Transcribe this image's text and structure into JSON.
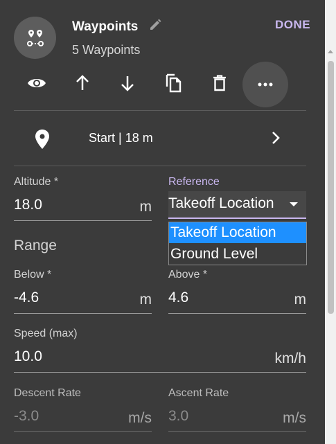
{
  "header": {
    "title": "Waypoints",
    "subtitle": "5 Waypoints",
    "done_label": "DONE"
  },
  "toolbar": {
    "icons": [
      "eye-icon",
      "arrow-up-icon",
      "arrow-down-icon",
      "copy-icon",
      "trash-icon",
      "more-horizontal-icon"
    ]
  },
  "start": {
    "label": "Start | 18 m"
  },
  "altitude": {
    "label": "Altitude *",
    "value": "18.0",
    "unit": "m"
  },
  "reference": {
    "label": "Reference",
    "selected": "Takeoff Location",
    "options": [
      "Takeoff Location",
      "Ground Level"
    ]
  },
  "range": {
    "heading": "Range",
    "below": {
      "label": "Below *",
      "value": "-4.6",
      "unit": "m"
    },
    "above": {
      "label": "Above *",
      "value": "4.6",
      "unit": "m"
    }
  },
  "speed": {
    "label": "Speed (max)",
    "value": "10.0",
    "unit": "km/h"
  },
  "descent": {
    "label": "Descent Rate",
    "value": "-3.0",
    "unit": "m/s"
  },
  "ascent": {
    "label": "Ascent Rate",
    "value": "3.0",
    "unit": "m/s"
  },
  "colors": {
    "panel_bg": "#3b3b3b",
    "accent": "#c9b7ef",
    "selection": "#1e90ff"
  }
}
